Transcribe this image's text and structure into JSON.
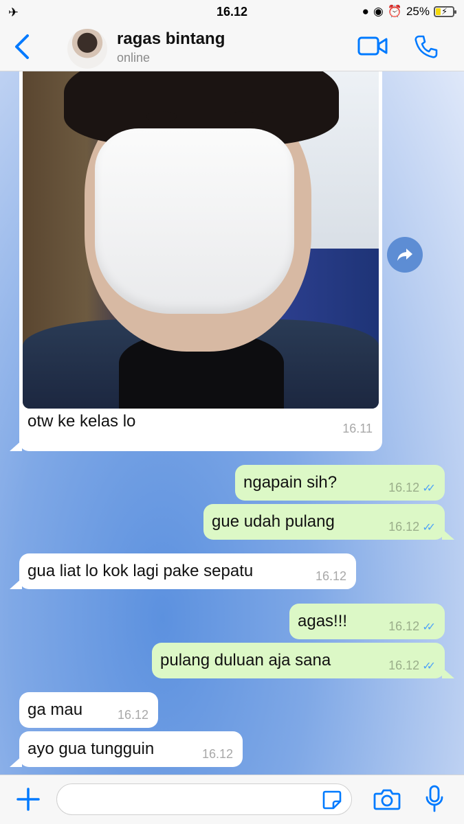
{
  "status_bar": {
    "time": "16.12",
    "battery": "25%",
    "icons": [
      "airplane-icon",
      "person-icon",
      "lock-rotation-icon",
      "alarm-icon",
      "battery-charging-icon"
    ]
  },
  "header": {
    "back_icon": "chevron-left-icon",
    "contact_name": "ragas bintang",
    "contact_status": "online",
    "video_icon": "video-camera-icon",
    "call_icon": "phone-icon"
  },
  "messages": [
    {
      "direction": "in",
      "type": "photo",
      "text": "otw ke kelas lo",
      "time": "16.11"
    },
    {
      "direction": "out",
      "text": "ngapain sih?",
      "time": "16.12",
      "status": "read"
    },
    {
      "direction": "out",
      "text": "gue udah pulang",
      "time": "16.12",
      "status": "read"
    },
    {
      "direction": "in",
      "text": "gua liat lo kok lagi pake sepatu",
      "time": "16.12"
    },
    {
      "direction": "out",
      "text": "agas!!!",
      "time": "16.12",
      "status": "read"
    },
    {
      "direction": "out",
      "text": "pulang duluan aja sana",
      "time": "16.12",
      "status": "read"
    },
    {
      "direction": "in",
      "text": "ga mau",
      "time": "16.12"
    },
    {
      "direction": "in",
      "text": "ayo gua tungguin",
      "time": "16.12"
    }
  ],
  "input_bar": {
    "message_value": "",
    "icons": [
      "plus-icon",
      "sticker-icon",
      "camera-icon",
      "microphone-icon"
    ]
  },
  "colors": {
    "accent": "#007aff",
    "outgoing_bubble": "#dcf8c6",
    "incoming_bubble": "#ffffff",
    "read_ticks": "#4fa3f7"
  }
}
